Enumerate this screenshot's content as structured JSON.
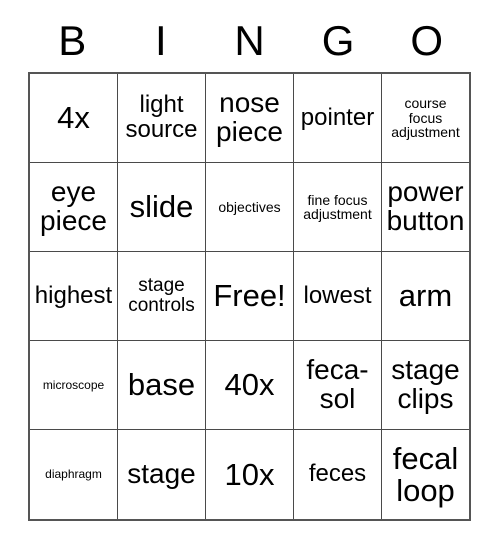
{
  "card": {
    "title": "Bingo Card",
    "headers": [
      "B",
      "I",
      "N",
      "G",
      "O"
    ],
    "free_space_label": "Free!",
    "colors": {
      "background": "#ffffff",
      "text": "#000000",
      "grid_line": "#4a4a4a",
      "grid_border": "#555555"
    },
    "rows": [
      [
        {
          "text": "4x",
          "size": "fs-xl"
        },
        {
          "text": "light\nsource",
          "size": "fs-md"
        },
        {
          "text": "nose\npiece",
          "size": "fs-lg"
        },
        {
          "text": "pointer",
          "size": "fs-md"
        },
        {
          "text": "course\nfocus\nadjustment",
          "size": "fs-xs"
        }
      ],
      [
        {
          "text": "eye\npiece",
          "size": "fs-lg"
        },
        {
          "text": "slide",
          "size": "fs-xl"
        },
        {
          "text": "objectives",
          "size": "fs-xs"
        },
        {
          "text": "fine focus\nadjustment",
          "size": "fs-xs"
        },
        {
          "text": "power\nbutton",
          "size": "fs-lg"
        }
      ],
      [
        {
          "text": "highest",
          "size": "fs-md"
        },
        {
          "text": "stage\ncontrols",
          "size": "fs-sm"
        },
        {
          "text": "Free!",
          "size": "fs-xl"
        },
        {
          "text": "lowest",
          "size": "fs-md"
        },
        {
          "text": "arm",
          "size": "fs-xl"
        }
      ],
      [
        {
          "text": "microscope",
          "size": "fs-xxs"
        },
        {
          "text": "base",
          "size": "fs-xl"
        },
        {
          "text": "40x",
          "size": "fs-xl"
        },
        {
          "text": "feca-\nsol",
          "size": "fs-lg"
        },
        {
          "text": "stage\nclips",
          "size": "fs-lg"
        }
      ],
      [
        {
          "text": "diaphragm",
          "size": "fs-xxs"
        },
        {
          "text": "stage",
          "size": "fs-lg"
        },
        {
          "text": "10x",
          "size": "fs-xl"
        },
        {
          "text": "feces",
          "size": "fs-md"
        },
        {
          "text": "fecal\nloop",
          "size": "fs-xl"
        }
      ]
    ]
  }
}
